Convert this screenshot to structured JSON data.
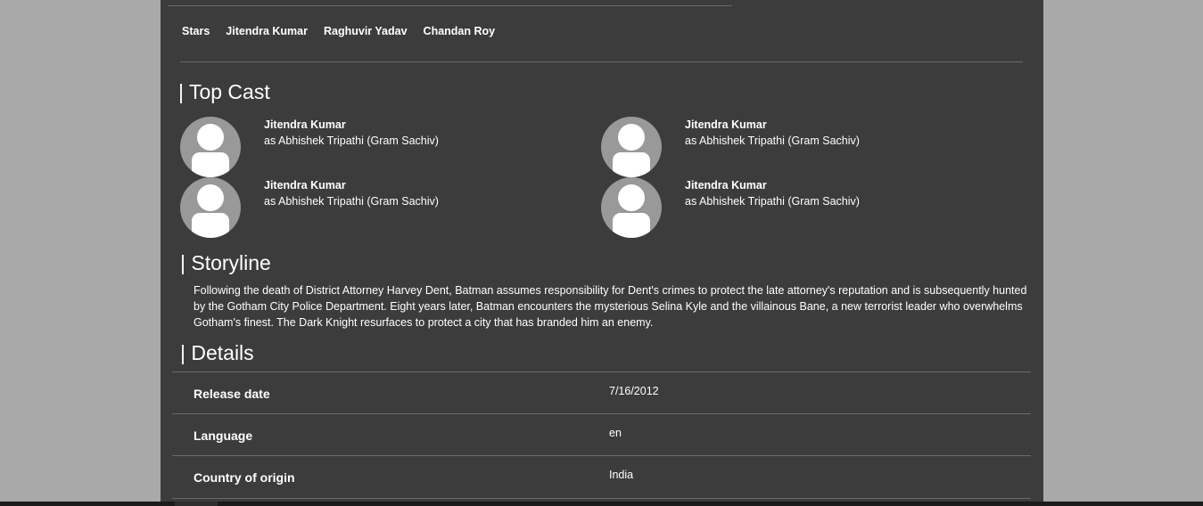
{
  "stars": {
    "label": "Stars",
    "names": [
      "Jitendra Kumar",
      "Raghuvir Yadav",
      "Chandan Roy"
    ]
  },
  "top_cast": {
    "title": "| Top Cast",
    "members": [
      {
        "name": "Jitendra Kumar",
        "role": "as Abhishek Tripathi (Gram Sachiv)"
      },
      {
        "name": "Jitendra Kumar",
        "role": "as Abhishek Tripathi (Gram Sachiv)"
      },
      {
        "name": "Jitendra Kumar",
        "role": "as Abhishek Tripathi (Gram Sachiv)"
      },
      {
        "name": "Jitendra Kumar",
        "role": "as Abhishek Tripathi (Gram Sachiv)"
      }
    ]
  },
  "storyline": {
    "title": "| Storyline",
    "text": "Following the death of District Attorney Harvey Dent, Batman assumes responsibility for Dent's crimes to protect the late attorney's reputation and is subsequently hunted by the Gotham City Police Department. Eight years later, Batman encounters the mysterious Selina Kyle and the villainous Bane, a new terrorist leader who overwhelms Gotham's finest. The Dark Knight resurfaces to protect a city that has branded him an enemy."
  },
  "details": {
    "title": "| Details",
    "rows": [
      {
        "label": "Release date",
        "value": "7/16/2012"
      },
      {
        "label": "Language",
        "value": "en"
      },
      {
        "label": "Country of origin",
        "value": "India"
      }
    ]
  },
  "colors": {
    "page_background": "#a9a9a9",
    "panel_background": "#3c3c3c",
    "avatar_background": "#999999",
    "divider": "#6a6a6a",
    "text": "#ffffff"
  }
}
